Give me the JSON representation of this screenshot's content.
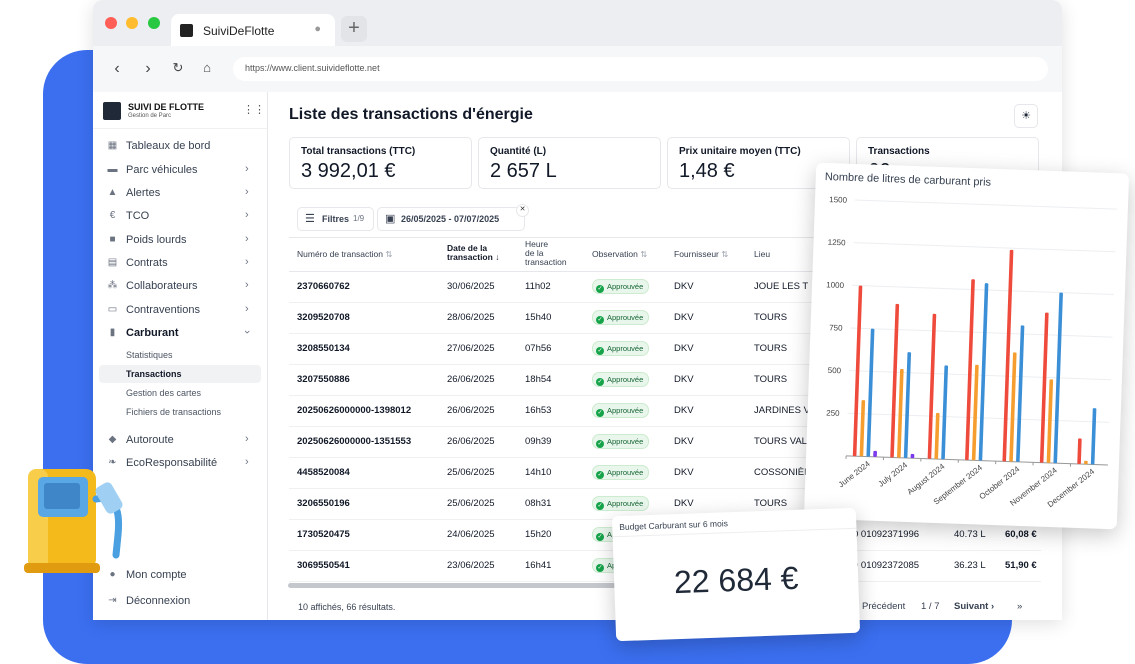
{
  "browser": {
    "tab_title": "SuiviDeFlotte",
    "url": "https://www.client.suivideflotte.net"
  },
  "brand": {
    "name": "SUIVI DE FLOTTE",
    "tagline": "Gestion de Parc"
  },
  "sidebar": {
    "items": [
      {
        "label": "Tableaux de bord",
        "icon": "dashboard-icon"
      },
      {
        "label": "Parc véhicules",
        "icon": "car-icon"
      },
      {
        "label": "Alertes",
        "icon": "bell-icon"
      },
      {
        "label": "TCO",
        "icon": "euro-icon"
      },
      {
        "label": "Poids lourds",
        "icon": "truck-icon"
      },
      {
        "label": "Contrats",
        "icon": "document-icon"
      },
      {
        "label": "Collaborateurs",
        "icon": "users-icon"
      },
      {
        "label": "Contraventions",
        "icon": "ticket-icon"
      },
      {
        "label": "Carburant",
        "icon": "fuel-icon"
      }
    ],
    "sub_items": [
      "Statistiques",
      "Transactions",
      "Gestion des cartes",
      "Fichiers de transactions"
    ],
    "items2": [
      {
        "label": "Autoroute",
        "icon": "road-icon"
      },
      {
        "label": "EcoResponsabilité",
        "icon": "leaf-icon"
      }
    ],
    "account": "Mon compte",
    "logout": "Déconnexion"
  },
  "page": {
    "title": "Liste des transactions d'énergie"
  },
  "kpis": [
    {
      "label": "Total transactions (TTC)",
      "value": "3 992,01 €"
    },
    {
      "label": "Quantité (L)",
      "value": "2 657 L"
    },
    {
      "label": "Prix unitaire moyen (TTC)",
      "value": "1,48 €"
    },
    {
      "label": "Transactions",
      "value": "66"
    }
  ],
  "filters": {
    "label": "Filtres",
    "count": "1/9",
    "date_range": "26/05/2025 - 07/07/2025"
  },
  "table": {
    "headers": {
      "num": "Numéro de transaction",
      "date1": "Date de la",
      "date2": "transaction",
      "heure1": "Heure",
      "heure2": "de la",
      "heure3": "transaction",
      "obs": "Observation",
      "fourn": "Fournisseur",
      "lieu": "Lieu"
    },
    "rows": [
      {
        "num": "2370660762",
        "date": "30/06/2025",
        "heure": "11h02",
        "obs": "Approuvée",
        "fourn": "DKV",
        "lieu": "JOUE LES T"
      },
      {
        "num": "3209520708",
        "date": "28/06/2025",
        "heure": "15h40",
        "obs": "Approuvée",
        "fourn": "DKV",
        "lieu": "TOURS"
      },
      {
        "num": "3208550134",
        "date": "27/06/2025",
        "heure": "07h56",
        "obs": "Approuvée",
        "fourn": "DKV",
        "lieu": "TOURS"
      },
      {
        "num": "3207550886",
        "date": "26/06/2025",
        "heure": "18h54",
        "obs": "Approuvée",
        "fourn": "DKV",
        "lieu": "TOURS"
      },
      {
        "num": "20250626000000-1398012",
        "date": "26/06/2025",
        "heure": "16h53",
        "obs": "Approuvée",
        "fourn": "DKV",
        "lieu": "JARDINES V"
      },
      {
        "num": "20250626000000-1351553",
        "date": "26/06/2025",
        "heure": "09h39",
        "obs": "Approuvée",
        "fourn": "DKV",
        "lieu": "TOURS VAL-"
      },
      {
        "num": "4458520084",
        "date": "25/06/2025",
        "heure": "14h10",
        "obs": "Approuvée",
        "fourn": "DKV",
        "lieu": "COSSONIÈR"
      },
      {
        "num": "3206550196",
        "date": "25/06/2025",
        "heure": "08h31",
        "obs": "Approuvée",
        "fourn": "DKV",
        "lieu": "TOURS"
      },
      {
        "num": "1730520475",
        "date": "24/06/2025",
        "heure": "15h20",
        "obs": "Approuvée",
        "fourn": "DKV",
        "lieu": "",
        "card": "0 01092371996",
        "qty": "40.73 L",
        "amount": "60,08 €"
      },
      {
        "num": "3069550541",
        "date": "23/06/2025",
        "heure": "16h41",
        "obs": "Approuvée",
        "fourn": "DKV",
        "lieu": "",
        "card": "0 01092372085",
        "qty": "36.23 L",
        "amount": "51,90 €"
      }
    ],
    "footer": "10 affichés, 66 résultats.",
    "pagination": {
      "prev": "Précédent",
      "page": "1 / 7",
      "next": "Suivant"
    }
  },
  "budget": {
    "title": "Budget Carburant sur 6 mois",
    "value": "22 684 €"
  },
  "chart_data": {
    "type": "bar",
    "title": "Nombre de litres de carburant pris",
    "categories": [
      "June 2024",
      "July 2024",
      "August 2024",
      "September 2024",
      "October 2024",
      "November 2024",
      "December 2024"
    ],
    "ylim": [
      0,
      1500
    ],
    "yticks": [
      0,
      250,
      500,
      750,
      1000,
      1250,
      1500
    ],
    "series": [
      {
        "values": [
          1000,
          900,
          850,
          1060,
          1240,
          880,
          150
        ],
        "color": "#ef4b3c"
      },
      {
        "values": [
          330,
          520,
          270,
          560,
          640,
          490,
          20
        ],
        "color": "#f59e2f"
      },
      {
        "values": [
          750,
          620,
          550,
          1040,
          800,
          1000,
          330
        ],
        "color": "#3b8fd6"
      },
      {
        "values": [
          35,
          25,
          0,
          0,
          0,
          0,
          0
        ],
        "color": "#7c3aed"
      }
    ]
  }
}
